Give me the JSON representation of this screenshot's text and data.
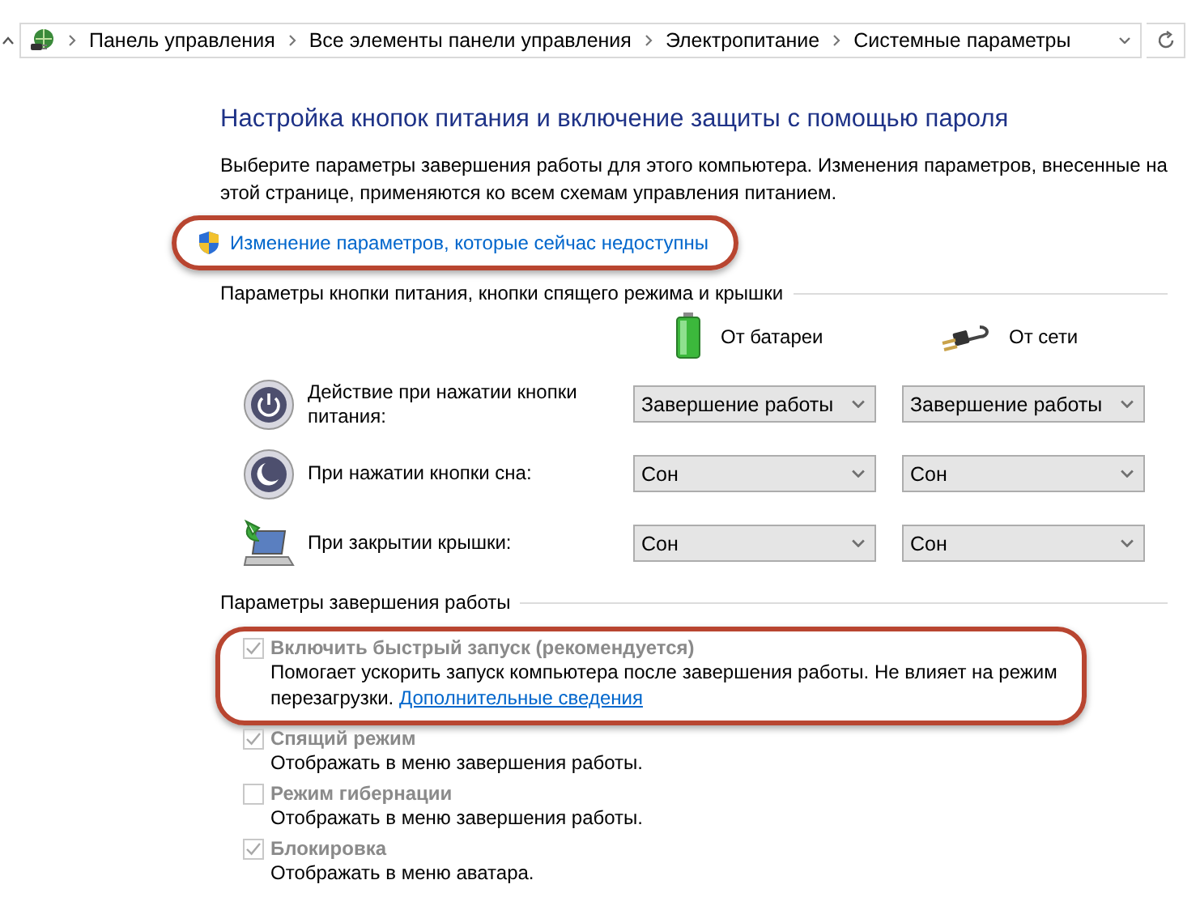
{
  "address_bar": {
    "breadcrumbs": [
      "Панель управления",
      "Все элементы панели управления",
      "Электропитание",
      "Системные параметры"
    ]
  },
  "heading": "Настройка кнопок питания и включение защиты с помощью пароля",
  "description": "Выберите параметры завершения работы для этого компьютера. Изменения параметров, внесенные на этой странице, применяются ко всем схемам управления питанием.",
  "admin_link": {
    "label": "Изменение параметров, которые сейчас недоступны",
    "circled": true
  },
  "buttons_section": {
    "title": "Параметры кнопки питания, кнопки спящего режима и крышки",
    "columns": [
      {
        "kind": "battery",
        "label": "От батареи"
      },
      {
        "kind": "plug",
        "label": "От сети"
      }
    ],
    "rows": [
      {
        "kind": "power",
        "label": "Действие при нажатии кнопки питания:",
        "values": [
          "Завершение работы",
          "Завершение работы"
        ]
      },
      {
        "kind": "sleep",
        "label": "При нажатии кнопки сна:",
        "values": [
          "Сон",
          "Сон"
        ]
      },
      {
        "kind": "lid",
        "label": "При закрытии крышки:",
        "values": [
          "Сон",
          "Сон"
        ]
      }
    ]
  },
  "shutdown_section": {
    "title": "Параметры завершения работы",
    "options": [
      {
        "label": "Включить быстрый запуск (рекомендуется)",
        "checked": true,
        "disabled": true,
        "circled": true,
        "description": "Помогает ускорить запуск компьютера после завершения работы. Не влияет на режим перезагрузки.",
        "link": "Дополнительные сведения"
      },
      {
        "label": "Спящий режим",
        "checked": true,
        "disabled": true,
        "circled": false,
        "description": "Отображать в меню завершения работы."
      },
      {
        "label": "Режим гибернации",
        "checked": false,
        "disabled": true,
        "circled": false,
        "description": "Отображать в меню завершения работы."
      },
      {
        "label": "Блокировка",
        "checked": true,
        "disabled": true,
        "circled": false,
        "description": "Отображать в меню аватара."
      }
    ]
  }
}
